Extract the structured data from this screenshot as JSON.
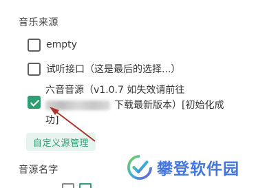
{
  "sections": {
    "music_source_title": "音乐来源",
    "source_name_title": "音源名字"
  },
  "options": [
    {
      "label": "empty",
      "checked": false
    },
    {
      "label": "试听接口（这是最后的选择...）",
      "checked": false
    },
    {
      "label_line1": "六音音源（v1.0.7 如失效请前往",
      "label_line2_suffix": "下载最新版本）[初始化成",
      "label_line3": "功]",
      "checked": true
    }
  ],
  "custom_source_button": "自定义源管理",
  "watermark": {
    "text": "攀登软件园",
    "icon": "checkmark-logo-icon"
  },
  "colors": {
    "accent": "#2f9e72",
    "accent_bg": "#e7f3ee",
    "arrow": "#b0342c",
    "watermark": "#3b6fe0"
  }
}
